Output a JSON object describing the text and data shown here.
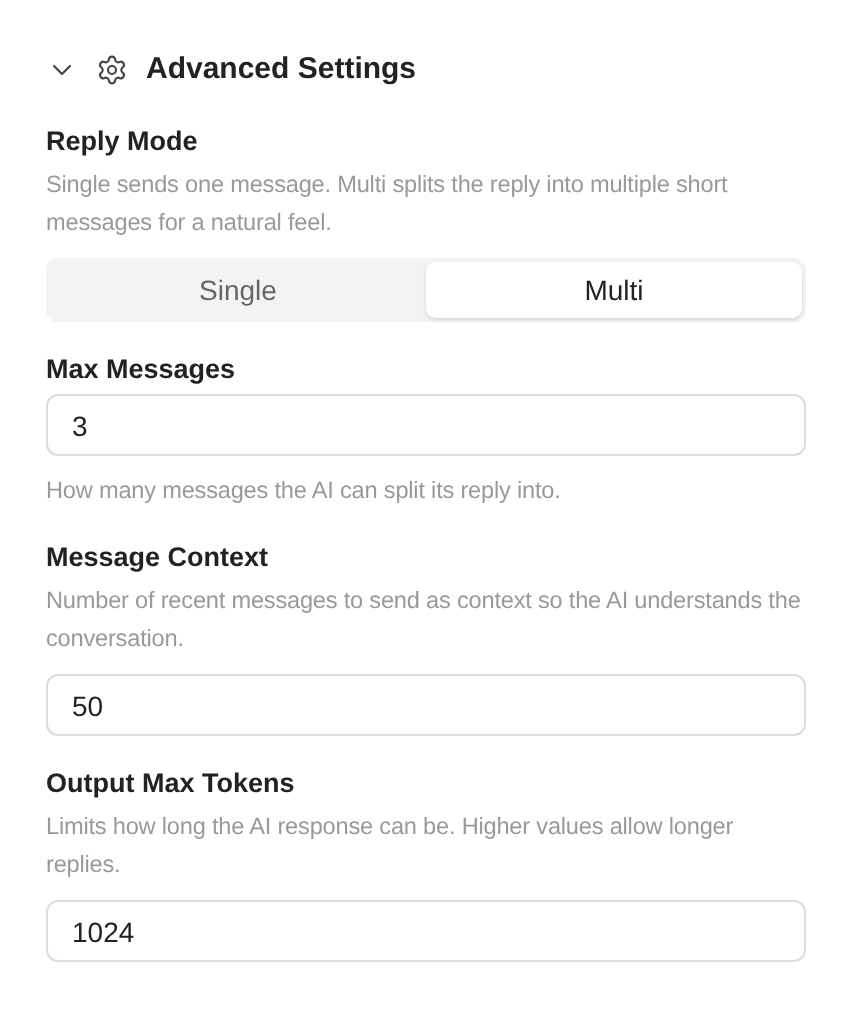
{
  "section": {
    "title": "Advanced Settings",
    "expanded": true
  },
  "fields": [
    {
      "kind": "segmented",
      "label": "Reply Mode",
      "description": "Single sends one message. Multi splits the reply into multiple short messages for a natural feel.",
      "options": [
        {
          "label": "Single",
          "selected": false
        },
        {
          "label": "Multi",
          "selected": true
        }
      ]
    },
    {
      "kind": "number",
      "label": "Max Messages",
      "value": "3",
      "hint": "How many messages the AI can split its reply into."
    },
    {
      "kind": "number",
      "label": "Message Context",
      "description": "Number of recent messages to send as context so the AI understands the conversation.",
      "value": "50"
    },
    {
      "kind": "number",
      "label": "Output Max Tokens",
      "description": "Limits how long the AI response can be. Higher values allow longer replies.",
      "value": "1024"
    }
  ]
}
